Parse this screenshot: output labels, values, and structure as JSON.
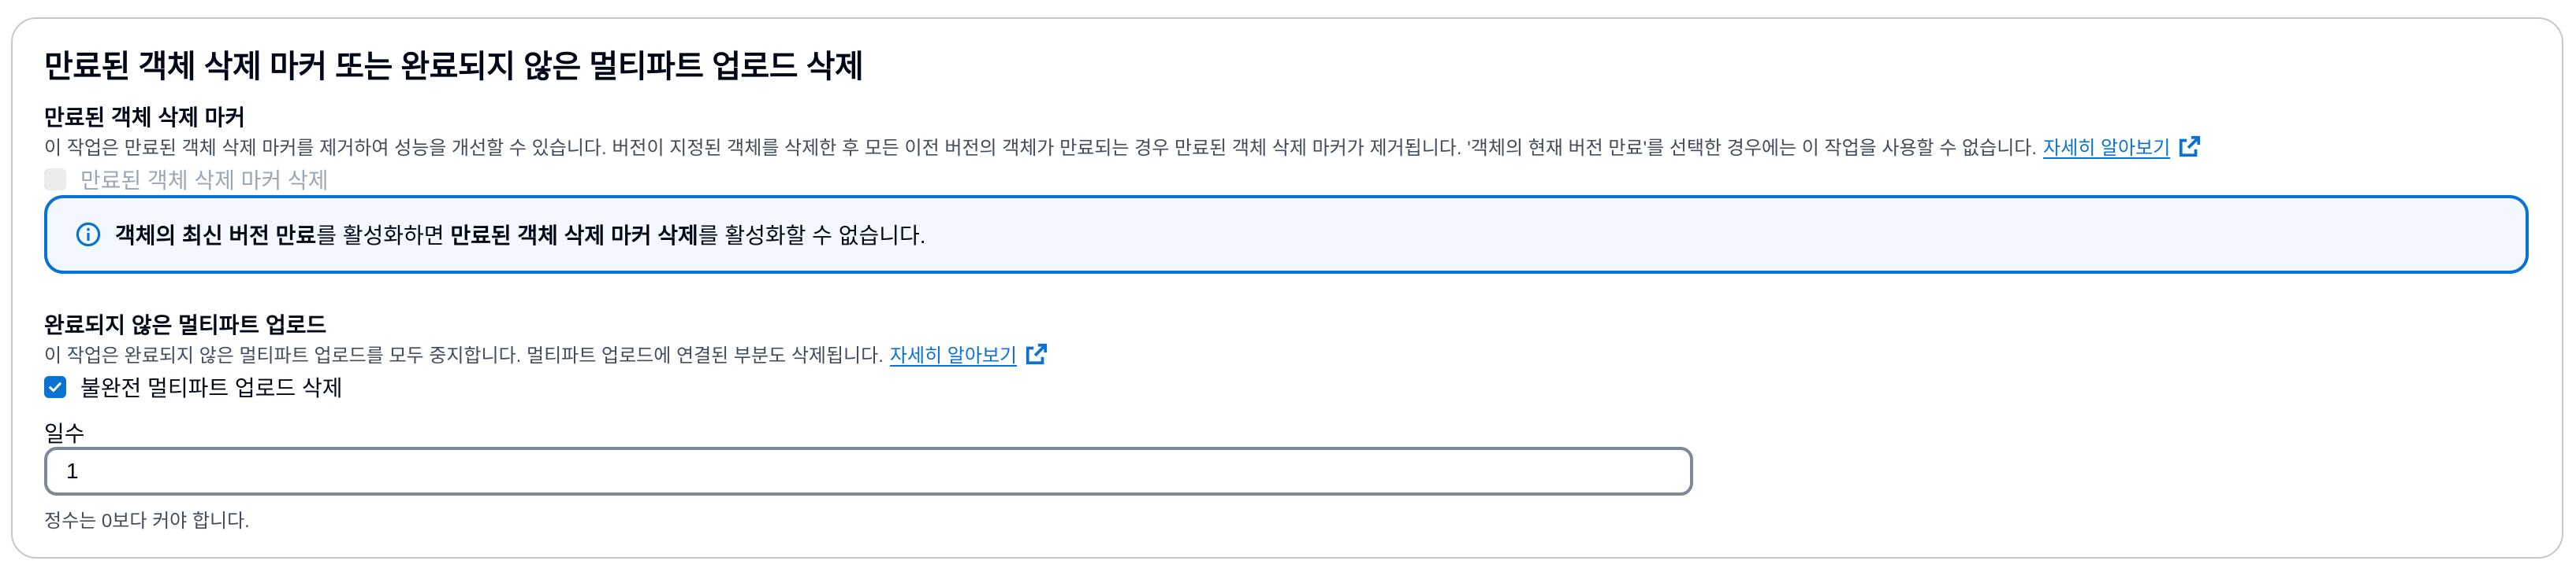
{
  "panel": {
    "title": "만료된 객체 삭제 마커 또는 완료되지 않은 멀티파트 업로드 삭제"
  },
  "expired_markers": {
    "heading": "만료된 객체 삭제 마커",
    "description": "이 작업은 만료된 객체 삭제 마커를 제거하여 성능을 개선할 수 있습니다. 버전이 지정된 객체를 삭제한 후 모든 이전 버전의 객체가 만료되는 경우 만료된 객체 삭제 마커가 제거됩니다. '객체의 현재 버전 만료'를 선택한 경우에는 이 작업을 사용할 수 없습니다.",
    "learn_more": "자세히 알아보기",
    "checkbox_label": "만료된 객체 삭제 마커 삭제",
    "checkbox_checked": false,
    "checkbox_disabled": true
  },
  "alert": {
    "icon": "info-icon",
    "bold1": "객체의 최신 버전 만료",
    "text1": "를 활성화하면 ",
    "bold2": "만료된 객체 삭제 마커 삭제",
    "text2": "를 활성화할 수 없습니다."
  },
  "incomplete_uploads": {
    "heading": "완료되지 않은 멀티파트 업로드",
    "description": "이 작업은 완료되지 않은 멀티파트 업로드를 모두 중지합니다. 멀티파트 업로드에 연결된 부분도 삭제됩니다.",
    "learn_more": "자세히 알아보기",
    "checkbox_label": "불완전 멀티파트 업로드 삭제",
    "checkbox_checked": true,
    "days_label": "일수",
    "days_value": "1",
    "days_hint": "정수는 0보다 커야 합니다."
  },
  "colors": {
    "link": "#0972d3",
    "alert_border": "#0972d3",
    "alert_bg": "#f2f8fd",
    "checkbox_checked": "#0972d3",
    "disabled_text": "#9ba7b6"
  }
}
